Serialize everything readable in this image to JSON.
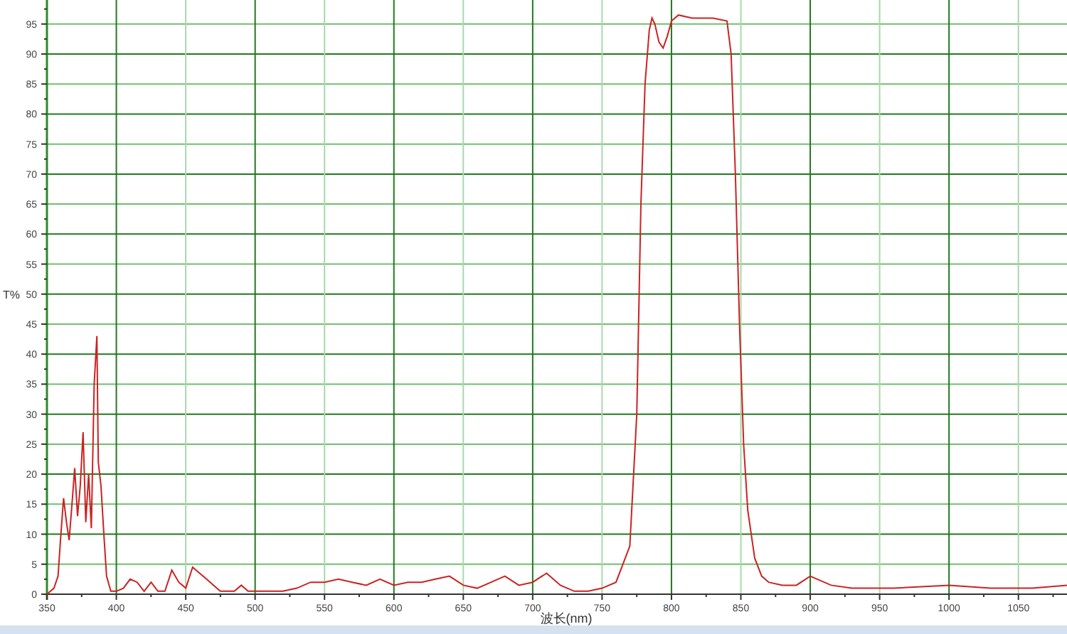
{
  "chart": {
    "chart_data": {
      "type": "line",
      "xlabel": "波长(nm)",
      "ylabel": "T%",
      "grid": true,
      "xlim": [
        350,
        1085
      ],
      "ylim": [
        0,
        99
      ],
      "xticks": [
        350,
        400,
        450,
        500,
        550,
        600,
        650,
        700,
        750,
        800,
        850,
        900,
        950,
        1000,
        1050
      ],
      "yticks": [
        0,
        5,
        10,
        15,
        20,
        25,
        30,
        35,
        40,
        45,
        50,
        55,
        60,
        65,
        70,
        75,
        80,
        85,
        90,
        95
      ],
      "x": [
        350,
        355,
        358,
        360,
        362,
        364,
        366,
        368,
        370,
        372,
        374,
        376,
        378,
        380,
        382,
        384,
        386,
        387,
        389,
        391,
        393,
        396,
        400,
        405,
        410,
        415,
        420,
        425,
        430,
        435,
        440,
        445,
        450,
        455,
        460,
        465,
        470,
        475,
        480,
        485,
        490,
        495,
        500,
        510,
        520,
        530,
        540,
        550,
        560,
        570,
        580,
        590,
        600,
        610,
        620,
        630,
        640,
        650,
        660,
        670,
        680,
        690,
        700,
        710,
        720,
        730,
        740,
        750,
        760,
        770,
        775,
        778,
        781,
        784,
        786,
        788,
        791,
        794,
        797,
        800,
        805,
        815,
        830,
        840,
        843,
        846,
        849,
        852,
        855,
        860,
        865,
        870,
        880,
        890,
        900,
        905,
        915,
        930,
        960,
        1000,
        1030,
        1060,
        1085
      ],
      "series": [
        {
          "color": "#cc2222",
          "values": [
            0,
            1,
            3,
            10,
            16,
            12,
            9,
            15,
            21,
            13,
            18,
            27,
            12,
            20,
            11,
            35,
            43,
            22,
            18,
            10,
            3,
            0.5,
            0.5,
            1,
            2.5,
            2,
            0.5,
            2,
            0.5,
            0.5,
            4,
            2,
            1,
            4.5,
            3.5,
            2.5,
            1.5,
            0.5,
            0.5,
            0.5,
            1.5,
            0.5,
            0.5,
            0.5,
            0.5,
            1,
            2,
            2,
            2.5,
            2,
            1.5,
            2.5,
            1.5,
            2,
            2,
            2.5,
            3,
            1.5,
            1,
            2,
            3,
            1.5,
            2,
            3.5,
            1.5,
            0.5,
            0.5,
            1,
            2,
            8,
            30,
            65,
            85,
            94,
            96,
            95,
            92,
            91,
            93,
            95.5,
            96.5,
            96,
            96,
            95.5,
            90,
            70,
            45,
            25,
            14,
            6,
            3,
            2,
            1.5,
            1.5,
            3,
            2.5,
            1.5,
            1,
            1,
            1.5,
            1,
            1,
            1.5
          ]
        }
      ]
    }
  }
}
